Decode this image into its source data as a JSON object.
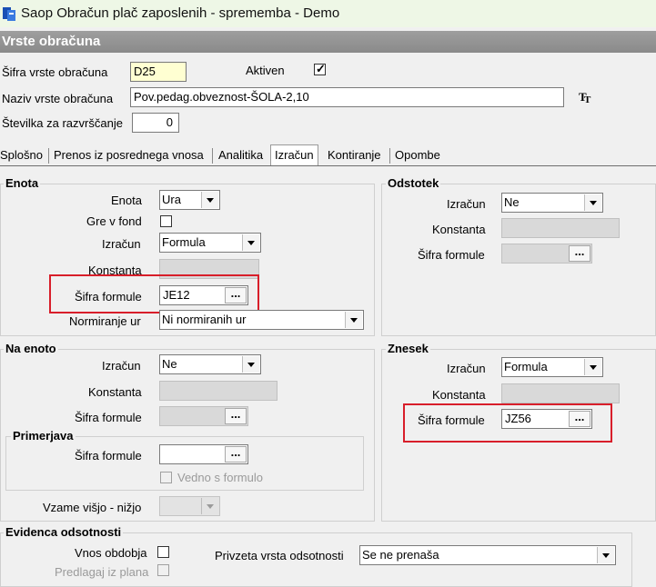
{
  "window": {
    "title": "Saop Obračun plač zaposlenih - sprememba - Demo"
  },
  "header": {
    "title": "Vrste obračuna"
  },
  "top": {
    "sifra_label": "Šifra vrste obračuna",
    "sifra_value": "D25",
    "aktiven_label": "Aktiven",
    "aktiven_checked": true,
    "naziv_label": "Naziv vrste obračuna",
    "naziv_value": "Pov.pedag.obveznost-ŠOLA-2,10",
    "stevilka_label": "Številka  za razvrščanje",
    "stevilka_value": "0",
    "font_icon": "font-tt-icon"
  },
  "tabs": [
    "Splošno",
    "Prenos iz posrednega vnosa",
    "Analitika",
    "Izračun",
    "Kontiranje",
    "Opombe"
  ],
  "active_tab": "Izračun",
  "enota": {
    "title": "Enota",
    "enota_label": "Enota",
    "enota_value": "Ura",
    "gre_label": "Gre v fond",
    "izracun_label": "Izračun",
    "izracun_value": "Formula",
    "konstanta_label": "Konstanta",
    "sifra_label": "Šifra formule",
    "sifra_value": "JE12",
    "norm_label": "Normiranje ur",
    "norm_value": "Ni normiranih ur"
  },
  "odstotek": {
    "title": "Odstotek",
    "izracun_label": "Izračun",
    "izracun_value": "Ne",
    "konstanta_label": "Konstanta",
    "sifra_label": "Šifra formule"
  },
  "na_enoto": {
    "title": "Na enoto",
    "izracun_label": "Izračun",
    "izracun_value": "Ne",
    "konstanta_label": "Konstanta",
    "sifra_label": "Šifra formule",
    "primerjava_title": "Primerjava",
    "primerjava_sifra_label": "Šifra formule",
    "vedno_label": "Vedno s formulo",
    "vzame_label": "Vzame višjo - nižjo"
  },
  "znesek": {
    "title": "Znesek",
    "izracun_label": "Izračun",
    "izracun_value": "Formula",
    "konstanta_label": "Konstanta",
    "sifra_label": "Šifra formule",
    "sifra_value": "JZ56"
  },
  "evidenca": {
    "title": "Evidenca odsotnosti",
    "vnos_label": "Vnos obdobja",
    "predlagaj_label": "Predlagaj iz plana",
    "privzeta_label": "Privzeta vrsta odsotnosti",
    "privzeta_value": "Se ne prenaša"
  },
  "lookup_button_label": "...",
  "highlight_color": "#d81e2a"
}
